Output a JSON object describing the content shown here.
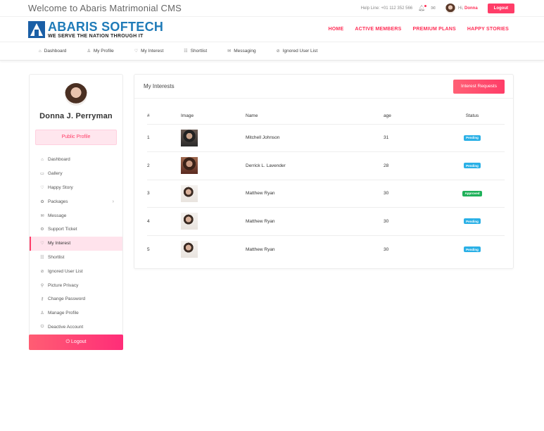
{
  "topbar": {
    "welcome": "Welcome to Abaris Matrimonial CMS",
    "helpline": "Help Line: +01 112 352 566",
    "hi": "Hi,",
    "user": "Donna",
    "logout": "Logout"
  },
  "brand": {
    "title": "ABARIS SOFTECH",
    "tagline": "WE SERVE THE NATION THROUGH IT"
  },
  "mainnav": [
    "HOME",
    "ACTIVE MEMBERS",
    "PREMIUM PLANS",
    "HAPPY STORIES"
  ],
  "subnav": [
    {
      "label": "Dashboard",
      "icon": "⌂"
    },
    {
      "label": "My Profile",
      "icon": "♙"
    },
    {
      "label": "My Interest",
      "icon": "♡"
    },
    {
      "label": "Shortlist",
      "icon": "☷"
    },
    {
      "label": "Messaging",
      "icon": "✉"
    },
    {
      "label": "Ignored User List",
      "icon": "⊘"
    }
  ],
  "profile": {
    "name": "Donna J. Perryman",
    "public_profile": "Public Profile"
  },
  "sidebar": [
    {
      "label": "Dashboard",
      "icon": "⌂"
    },
    {
      "label": "Gallery",
      "icon": "▭"
    },
    {
      "label": "Happy Story",
      "icon": "♡"
    },
    {
      "label": "Packages",
      "icon": "✿"
    },
    {
      "label": "Message",
      "icon": "✉"
    },
    {
      "label": "Support Ticket",
      "icon": "⚙"
    },
    {
      "label": "My Interest",
      "icon": "♡"
    },
    {
      "label": "Shortlist",
      "icon": "☷"
    },
    {
      "label": "Ignored User List",
      "icon": "⊘"
    },
    {
      "label": "Picture Privacy",
      "icon": "⚲"
    },
    {
      "label": "Change Password",
      "icon": "⚷"
    },
    {
      "label": "Manage Profile",
      "icon": "♙"
    },
    {
      "label": "Deactive Account",
      "icon": "⏻"
    }
  ],
  "sidebar_active": "My Interest",
  "sidebar_logout": "Logout",
  "panel": {
    "title": "My Interests",
    "request_button": "Interest Requests",
    "columns": [
      "#",
      "Image",
      "Name",
      "age",
      "Status"
    ],
    "rows": [
      {
        "no": "1",
        "name": "Mitchell Johnson",
        "age": "31",
        "status": "Pending"
      },
      {
        "no": "2",
        "name": "Derrick L. Lavender",
        "age": "28",
        "status": "Pending"
      },
      {
        "no": "3",
        "name": "Matthew Ryan",
        "age": "30",
        "status": "Approved"
      },
      {
        "no": "4",
        "name": "Matthew Ryan",
        "age": "30",
        "status": "Pending"
      },
      {
        "no": "5",
        "name": "Matthew Ryan",
        "age": "30",
        "status": "Pending"
      }
    ]
  },
  "colors": {
    "accent": "#ff3d68",
    "brand_blue": "#1f7bb8",
    "pending": "#2ab0e6",
    "approved": "#1fb15a"
  }
}
